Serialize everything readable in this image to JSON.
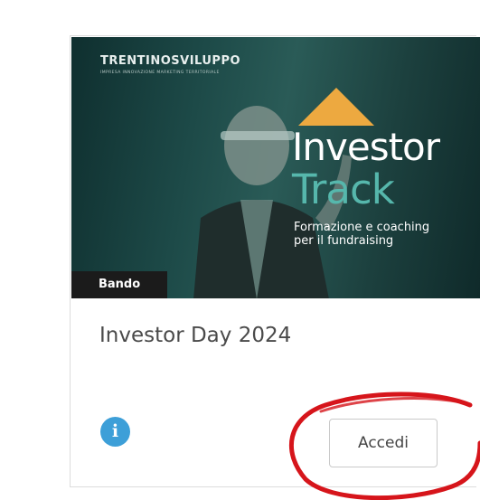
{
  "banner": {
    "brand_prefix": "TRENTINO",
    "brand_suffix": "SVILUPPO",
    "brand_sub": "IMPRESA INNOVAZIONE MARKETING TERRITORIALE",
    "title_line1": "Investor",
    "title_line2": "Track",
    "tagline_line1": "Formazione e coaching",
    "tagline_line2": "per il fundraising",
    "accent_color": "#eda940",
    "track_color": "#56b7ac"
  },
  "badge": {
    "label": "Bando"
  },
  "card": {
    "title": "Investor Day 2024",
    "info_glyph": "i",
    "action_label": "Accedi"
  },
  "annotation": {
    "color": "#d6151b"
  }
}
